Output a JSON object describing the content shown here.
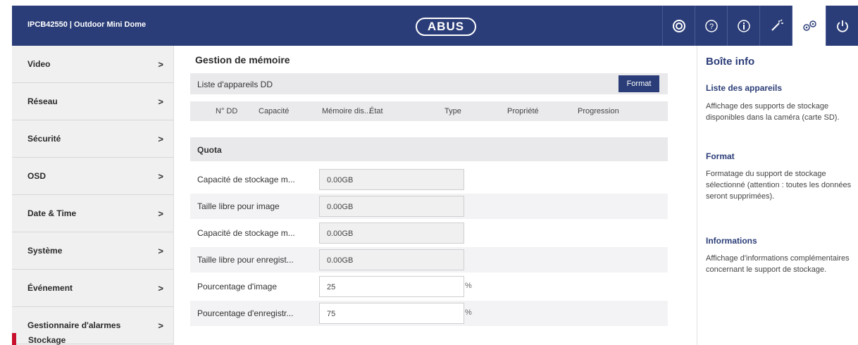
{
  "header": {
    "device_title": "IPCB42550  |  Outdoor Mini Dome",
    "brand": "ABUS",
    "icons": [
      "camera-live-icon",
      "help-icon",
      "info-icon",
      "magic-wand-icon",
      "settings-gears-icon",
      "power-icon"
    ],
    "active_icon": "settings-gears-icon",
    "color_primary": "#2b3d78"
  },
  "sidebar": {
    "items": [
      {
        "label": "Video"
      },
      {
        "label": "Réseau"
      },
      {
        "label": "Sécurité"
      },
      {
        "label": "OSD"
      },
      {
        "label": "Date & Time"
      },
      {
        "label": "Système"
      },
      {
        "label": "Événement"
      },
      {
        "label": "Gestionnaire d'alarmes"
      }
    ],
    "chevron": ">",
    "partial_item": "Stockage",
    "accent_color": "#c8102e"
  },
  "main": {
    "title": "Gestion de mémoire",
    "device_list_label": "Liste d'appareils DD",
    "format_button": "Format",
    "columns": [
      "N° DD",
      "Capacité",
      "Mémoire dis...",
      "État",
      "Type",
      "Propriété",
      "Progression"
    ],
    "quota_label": "Quota",
    "fields": [
      {
        "label": "Capacité de stockage m...",
        "value": "0.00GB"
      },
      {
        "label": "Taille libre pour image",
        "value": "0.00GB"
      },
      {
        "label": "Capacité de stockage m...",
        "value": "0.00GB"
      },
      {
        "label": "Taille libre pour enregist...",
        "value": "0.00GB"
      },
      {
        "label": "Pourcentage d'image",
        "value": "25",
        "unit": "%"
      },
      {
        "label": "Pourcentage d'enregistr...",
        "value": "75",
        "unit": "%"
      }
    ]
  },
  "info": {
    "title": "Boîte info",
    "sections": [
      {
        "heading": "Liste des appareils",
        "text": "Affichage des supports de stockage disponibles dans la caméra (carte SD)."
      },
      {
        "heading": "Format",
        "text": "Formatage du support de stockage sélectionné (attention : toutes les données seront supprimées)."
      },
      {
        "heading": "Informations",
        "text": "Affichage d'informations complémentaires concernant le support de stockage."
      }
    ]
  }
}
